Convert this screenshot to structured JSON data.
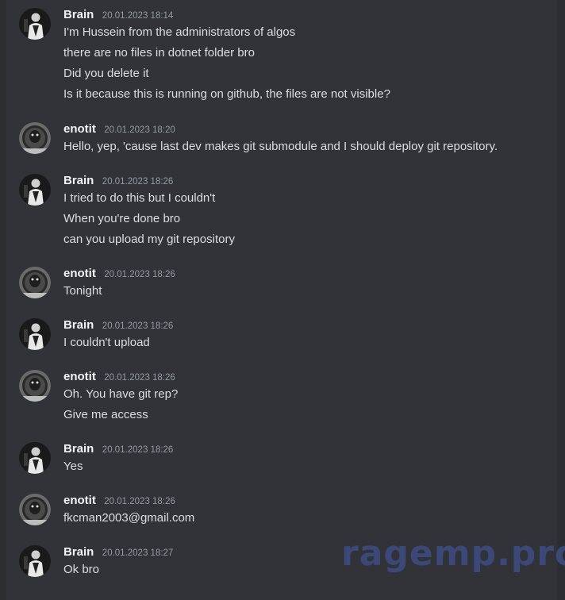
{
  "colors": {
    "background": "#313338",
    "username": "#f2f3f5",
    "timestamp": "#949ba4",
    "text": "#dbdee1",
    "watermark": "#3e4e84"
  },
  "messages": [
    {
      "author": "Brain",
      "time": "20.01.2023 18:14",
      "avatar_icon": "brain-avatar-icon",
      "lines": [
        "I'm Hussein from the administrators of algos",
        "there are no files in dotnet folder bro",
        "Did you delete it",
        "Is it because this is running on github, the files are not visible?"
      ]
    },
    {
      "author": "enotit",
      "time": "20.01.2023 18:20",
      "avatar_icon": "enotit-avatar-icon",
      "lines": [
        "Hello, yep, 'cause last dev makes git submodule and I should deploy git repository."
      ]
    },
    {
      "author": "Brain",
      "time": "20.01.2023 18:26",
      "avatar_icon": "brain-avatar-icon",
      "lines": [
        "I tried to do this but I couldn't",
        "When you're done bro",
        "can you upload my git repository"
      ]
    },
    {
      "author": "enotit",
      "time": "20.01.2023 18:26",
      "avatar_icon": "enotit-avatar-icon",
      "lines": [
        "Tonight"
      ]
    },
    {
      "author": "Brain",
      "time": "20.01.2023 18:26",
      "avatar_icon": "brain-avatar-icon",
      "lines": [
        "I couldn't upload"
      ]
    },
    {
      "author": "enotit",
      "time": "20.01.2023 18:26",
      "avatar_icon": "enotit-avatar-icon",
      "lines": [
        "Oh. You have git rep?",
        "Give me access"
      ]
    },
    {
      "author": "Brain",
      "time": "20.01.2023 18:26",
      "avatar_icon": "brain-avatar-icon",
      "lines": [
        "Yes"
      ]
    },
    {
      "author": "enotit",
      "time": "20.01.2023 18:26",
      "avatar_icon": "enotit-avatar-icon",
      "lines": [
        "fkcman2003@gmail.com"
      ]
    },
    {
      "author": "Brain",
      "time": "20.01.2023 18:27",
      "avatar_icon": "brain-avatar-icon",
      "lines": [
        "Ok bro"
      ]
    }
  ],
  "watermark": "ragemp.pro"
}
